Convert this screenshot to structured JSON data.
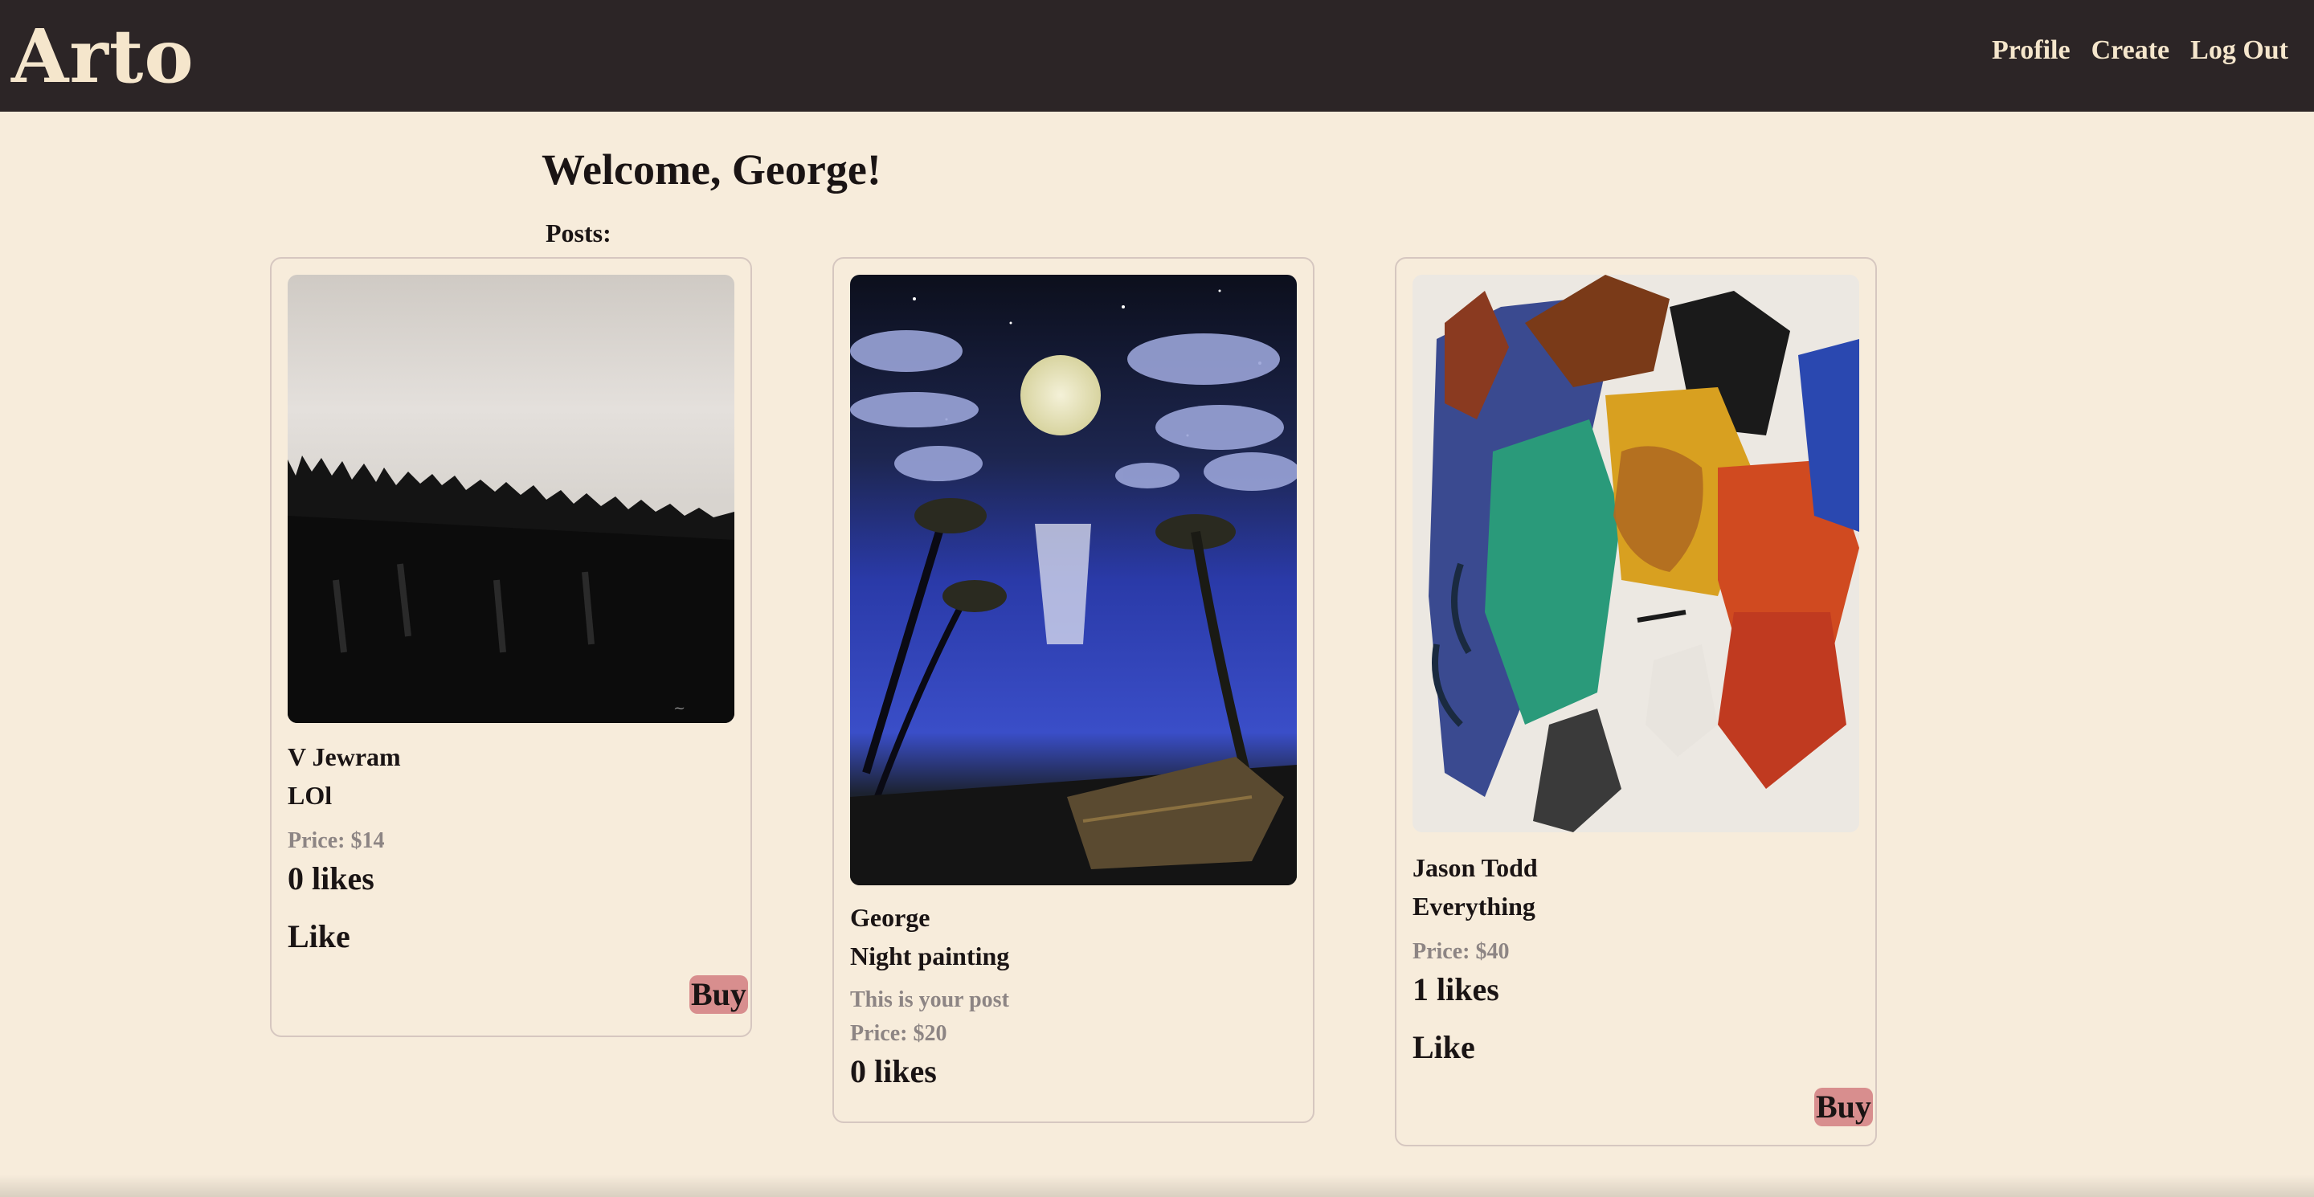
{
  "nav": {
    "logo": "Arto",
    "links": [
      "Profile",
      "Create",
      "Log Out"
    ]
  },
  "welcome": "Welcome, George!",
  "posts_label": "Posts:",
  "posts": [
    {
      "artist": "V Jewram",
      "title": "LOl",
      "price": "Price: $14",
      "likes": "0 likes",
      "like_label": "Like",
      "buy_label": "Buy"
    },
    {
      "artist": "George",
      "title": "Night painting",
      "own_note": "This is your post",
      "price": "Price: $20",
      "likes": "0 likes"
    },
    {
      "artist": "Jason Todd",
      "title": "Everything",
      "price": "Price: $40",
      "likes": "1 likes",
      "like_label": "Like",
      "buy_label": "Buy"
    }
  ]
}
